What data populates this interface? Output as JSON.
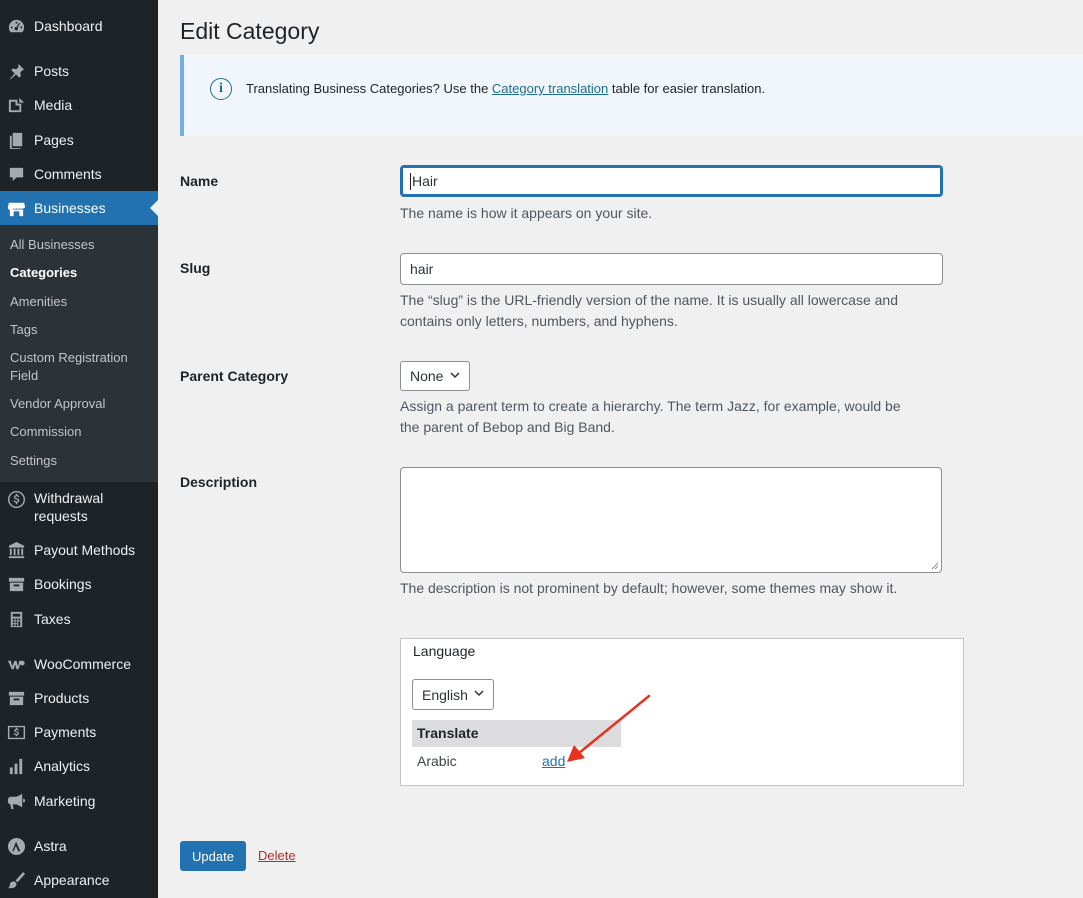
{
  "sidebar": {
    "items": [
      {
        "label": "Dashboard",
        "icon": "dashboard-icon"
      },
      {
        "label": "Posts",
        "icon": "pin-icon"
      },
      {
        "label": "Media",
        "icon": "media-icon"
      },
      {
        "label": "Pages",
        "icon": "pages-icon"
      },
      {
        "label": "Comments",
        "icon": "comment-icon"
      },
      {
        "label": "Businesses",
        "icon": "store-icon"
      },
      {
        "label": "Withdrawal requests",
        "icon": "dollar-icon"
      },
      {
        "label": "Payout Methods",
        "icon": "bank-icon"
      },
      {
        "label": "Bookings",
        "icon": "archive-icon"
      },
      {
        "label": "Taxes",
        "icon": "calculator-icon"
      },
      {
        "label": "WooCommerce",
        "icon": "woocommerce-icon"
      },
      {
        "label": "Products",
        "icon": "archive-icon"
      },
      {
        "label": "Payments",
        "icon": "payment-icon"
      },
      {
        "label": "Analytics",
        "icon": "bar-chart-icon"
      },
      {
        "label": "Marketing",
        "icon": "megaphone-icon"
      },
      {
        "label": "Astra",
        "icon": "astra-icon"
      },
      {
        "label": "Appearance",
        "icon": "brush-icon"
      }
    ],
    "submenu": [
      "All Businesses",
      "Categories",
      "Amenities",
      "Tags",
      "Custom Registration Field",
      "Vendor Approval",
      "Commission",
      "Settings"
    ]
  },
  "page": {
    "title": "Edit Category",
    "notice": {
      "before": "Translating Business Categories? Use the ",
      "link": "Category translation",
      "after": " table for easier translation."
    }
  },
  "form": {
    "name_label": "Name",
    "name_value": "Hair",
    "name_desc": "The name is how it appears on your site.",
    "slug_label": "Slug",
    "slug_value": "hair",
    "slug_desc_1": "The “slug” is the URL-friendly version of the name. It is usually all lowercase and",
    "slug_desc_2": "contains only letters, numbers, and hyphens.",
    "parent_label": "Parent Category",
    "parent_value": "None",
    "parent_desc_1": "Assign a parent term to create a hierarchy. The term Jazz, for example, would be",
    "parent_desc_2": "the parent of Bebop and Big Band.",
    "description_label": "Description",
    "description_value": "",
    "description_desc": "The description is not prominent by default; however, some themes may show it."
  },
  "language": {
    "title": "Language",
    "selected": "English",
    "translate_header": "Translate",
    "row_language": "Arabic",
    "row_action": "add"
  },
  "actions": {
    "update": "Update",
    "delete": "Delete"
  },
  "colors": {
    "sidebar_bg": "#1d2327",
    "accent": "#2271b1",
    "delete": "#b32d2e",
    "arrow": "#e8321f"
  }
}
